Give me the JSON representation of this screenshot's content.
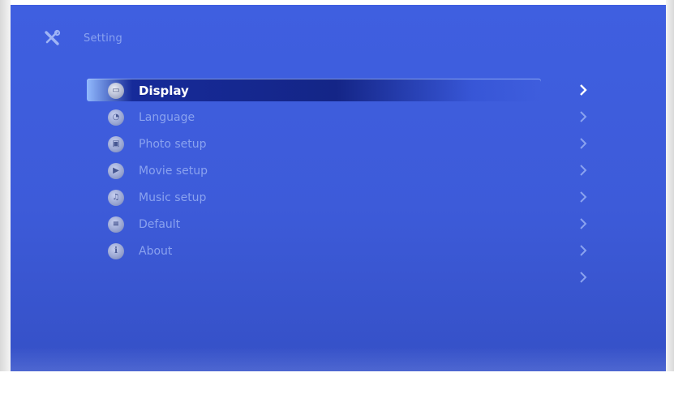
{
  "header": {
    "title": "Setting",
    "icon": "tools-icon"
  },
  "menu": {
    "items": [
      {
        "label": "Display",
        "icon": "display-icon",
        "active": true
      },
      {
        "label": "Language",
        "icon": "language-icon",
        "active": false
      },
      {
        "label": "Photo setup",
        "icon": "photo-icon",
        "active": false
      },
      {
        "label": "Movie setup",
        "icon": "movie-icon",
        "active": false
      },
      {
        "label": "Music setup",
        "icon": "music-icon",
        "active": false
      },
      {
        "label": "Default",
        "icon": "default-icon",
        "active": false
      },
      {
        "label": "About",
        "icon": "info-icon",
        "active": false
      },
      {
        "label": "",
        "icon": "",
        "active": false
      }
    ]
  },
  "colors": {
    "background": "#3d5bd9",
    "highlight": "#14228a",
    "text_dim": "#8aa2ef",
    "text_active": "#ffffff"
  }
}
